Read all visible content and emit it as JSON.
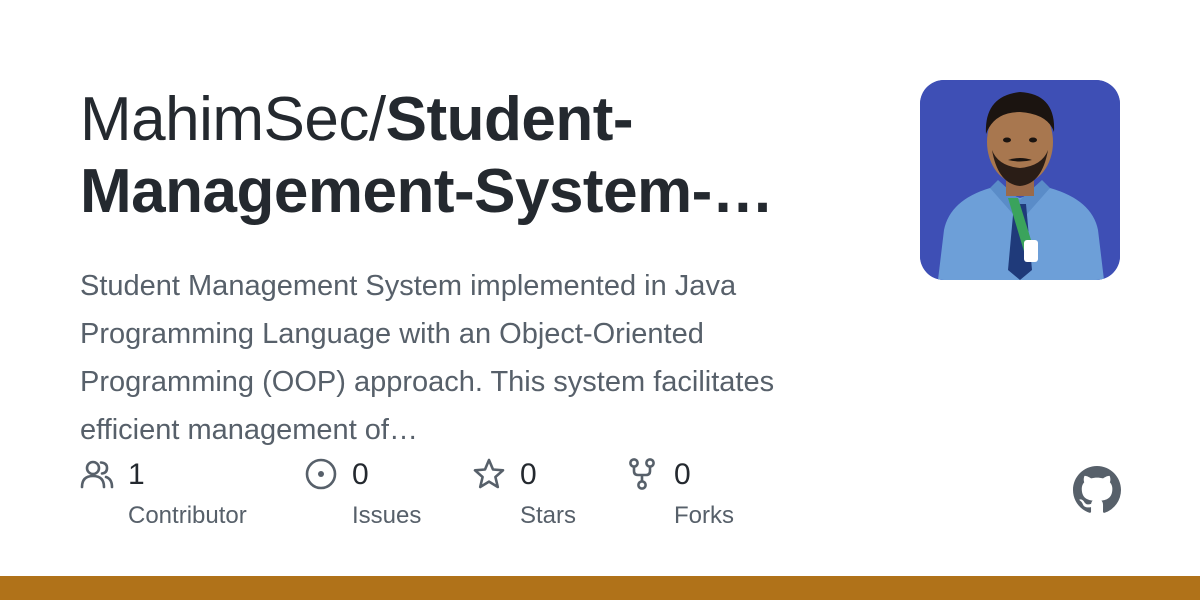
{
  "header": {
    "owner": "MahimSec/",
    "repo": "Student-Management-System-…"
  },
  "description": "Student Management System implemented in Java Programming Language with an Object-Oriented Programming (OOP) approach. This system facilitates efficient management of…",
  "avatar": {
    "icon": "user-avatar-photo",
    "background": "#3e4fb5"
  },
  "stats": {
    "contributors": {
      "count": "1",
      "label": "Contributor",
      "icon": "people-icon"
    },
    "issues": {
      "count": "0",
      "label": "Issues",
      "icon": "issue-opened-icon"
    },
    "stars": {
      "count": "0",
      "label": "Stars",
      "icon": "star-icon"
    },
    "forks": {
      "count": "0",
      "label": "Forks",
      "icon": "repo-forked-icon"
    }
  },
  "colors": {
    "title": "#24292f",
    "muted": "#57606a",
    "icon": "#57606a",
    "language_bar": "#b07219"
  }
}
